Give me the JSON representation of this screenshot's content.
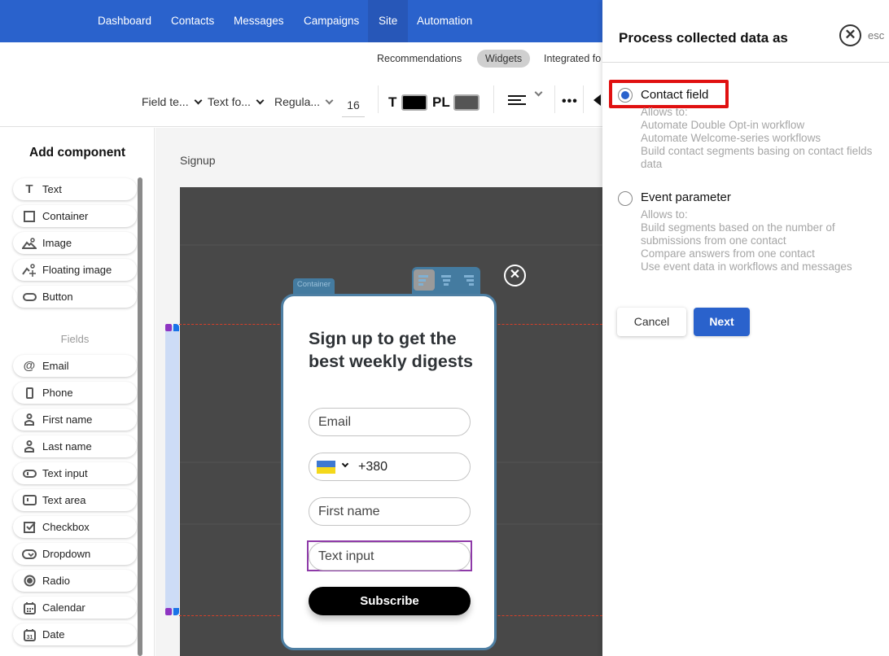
{
  "nav": {
    "items": [
      {
        "label": "Dashboard",
        "active": false
      },
      {
        "label": "Contacts",
        "active": false
      },
      {
        "label": "Messages",
        "active": false
      },
      {
        "label": "Campaigns",
        "active": false
      },
      {
        "label": "Site",
        "active": true
      },
      {
        "label": "Automation",
        "active": false
      }
    ],
    "color": "#2a62cc"
  },
  "subnav": {
    "items": [
      {
        "label": "Recommendations",
        "active": false
      },
      {
        "label": "Widgets",
        "active": true
      },
      {
        "label": "Integrated fo",
        "active": false
      }
    ]
  },
  "toolbar": {
    "field_text": "Field te...",
    "text_format": "Text fo...",
    "font_weight": "Regula...",
    "font_size": "16",
    "text_color_label": "T",
    "text_color": "#000000",
    "placeholder_color_label": "PL",
    "placeholder_color": "#555555",
    "align_icon": "align-left-icon",
    "more_icon": "more-horizontal-icon",
    "back_icon": "arrow-left-icon"
  },
  "sidebar": {
    "title": "Add component",
    "components": [
      {
        "label": "Text",
        "icon": "text-icon"
      },
      {
        "label": "Container",
        "icon": "square-icon"
      },
      {
        "label": "Image",
        "icon": "image-icon"
      },
      {
        "label": "Floating image",
        "icon": "floating-image-icon"
      },
      {
        "label": "Button",
        "icon": "button-icon"
      }
    ],
    "fields_label": "Fields",
    "fields": [
      {
        "label": "Email",
        "icon": "at-icon"
      },
      {
        "label": "Phone",
        "icon": "phone-icon"
      },
      {
        "label": "First name",
        "icon": "person-icon"
      },
      {
        "label": "Last name",
        "icon": "person-icon"
      },
      {
        "label": "Text input",
        "icon": "text-input-icon"
      },
      {
        "label": "Text area",
        "icon": "text-area-icon"
      },
      {
        "label": "Checkbox",
        "icon": "checkbox-icon"
      },
      {
        "label": "Dropdown",
        "icon": "dropdown-icon"
      },
      {
        "label": "Radio",
        "icon": "radio-icon"
      },
      {
        "label": "Calendar",
        "icon": "calendar-icon"
      },
      {
        "label": "Date",
        "icon": "date-icon"
      }
    ]
  },
  "workspace": {
    "widget_name": "Signup",
    "container_tag": "Container",
    "popup": {
      "title": "Sign up to get the best weekly digests",
      "email_placeholder": "Email",
      "phone_code": "+380",
      "phone_flag": "Ukraine",
      "first_name_placeholder": "First name",
      "text_input_placeholder": "Text input",
      "subscribe_label": "Subscribe"
    }
  },
  "panel": {
    "title": "Process collected data as",
    "esc_label": "esc",
    "options": [
      {
        "label": "Contact field",
        "checked": true,
        "description": [
          "Allows to:",
          "Automate Double Opt-in workflow",
          "Automate Welcome-series workflows",
          "Build contact segments basing on contact fields",
          "data"
        ]
      },
      {
        "label": "Event parameter",
        "checked": false,
        "description": [
          "Allows to:",
          "Build segments based on the number of",
          "submissions from one contact",
          "Compare answers from one contact",
          "Use event data in workflows and messages"
        ]
      }
    ],
    "cancel_label": "Cancel",
    "next_label": "Next"
  }
}
